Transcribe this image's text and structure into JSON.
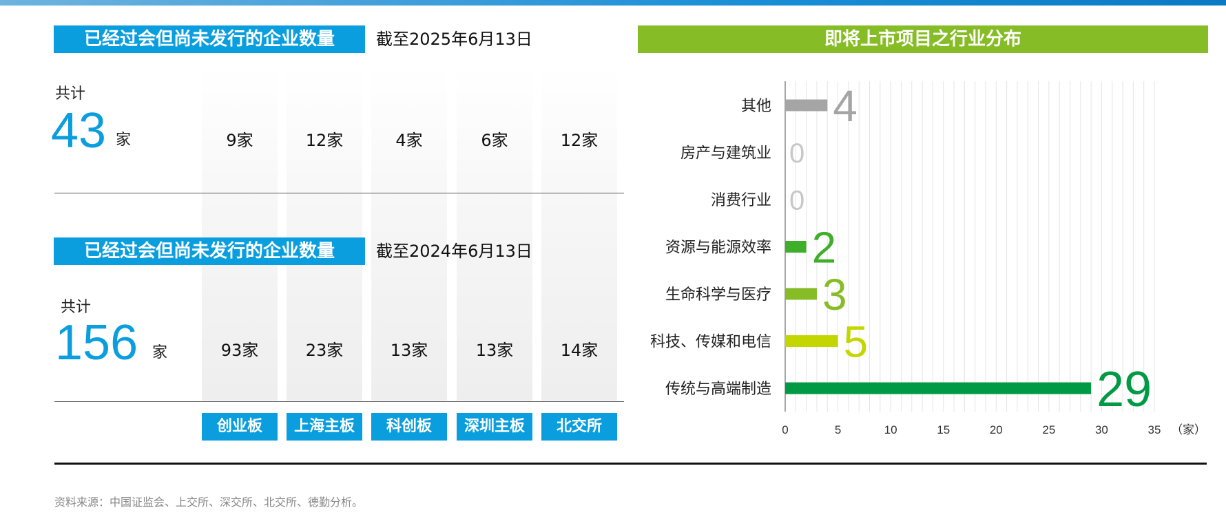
{
  "left_panel": {
    "row_2025": {
      "title": "已经过会但尚未发行的企业数量",
      "as_of": "截至2025年6月13日",
      "total_label": "共计",
      "total_value": "43",
      "total_unit": "家",
      "cells": [
        "9家",
        "12家",
        "4家",
        "6家",
        "12家"
      ]
    },
    "row_2024": {
      "title": "已经过会但尚未发行的企业数量",
      "as_of": "截至2024年6月13日",
      "total_label": "共计",
      "total_value": "156",
      "total_unit": "家",
      "cells": [
        "93家",
        "23家",
        "13家",
        "13家",
        "14家"
      ]
    },
    "boards": [
      "创业板",
      "上海主板",
      "科创板",
      "深圳主板",
      "北交所"
    ]
  },
  "right_panel": {
    "title": "即将上市项目之行业分布"
  },
  "chart_data": {
    "type": "bar",
    "orientation": "horizontal",
    "categories": [
      "其他",
      "房产与建筑业",
      "消费行业",
      "资源与能源效率",
      "生命科学与医疗",
      "科技、传媒和电信",
      "传统与高端制造"
    ],
    "values": [
      4,
      0,
      0,
      2,
      3,
      5,
      29
    ],
    "bar_colors": [
      "#a5a5a5",
      "#bfbfbf",
      "#bfbfbf",
      "#3fae2a",
      "#86bc25",
      "#c4d600",
      "#009a44"
    ],
    "label_colors": [
      "#a5a5a5",
      "#c8c8c8",
      "#c8c8c8",
      "#3fae2a",
      "#86bc25",
      "#c4d600",
      "#009a44"
    ],
    "xlim": [
      0,
      35
    ],
    "xticks": [
      0,
      5,
      10,
      15,
      20,
      25,
      30,
      35
    ],
    "x_unit": "（家）",
    "grid": true
  },
  "footer": {
    "source": "资料来源：中国证监会、上交所、深交所、北交所、德勤分析。"
  }
}
